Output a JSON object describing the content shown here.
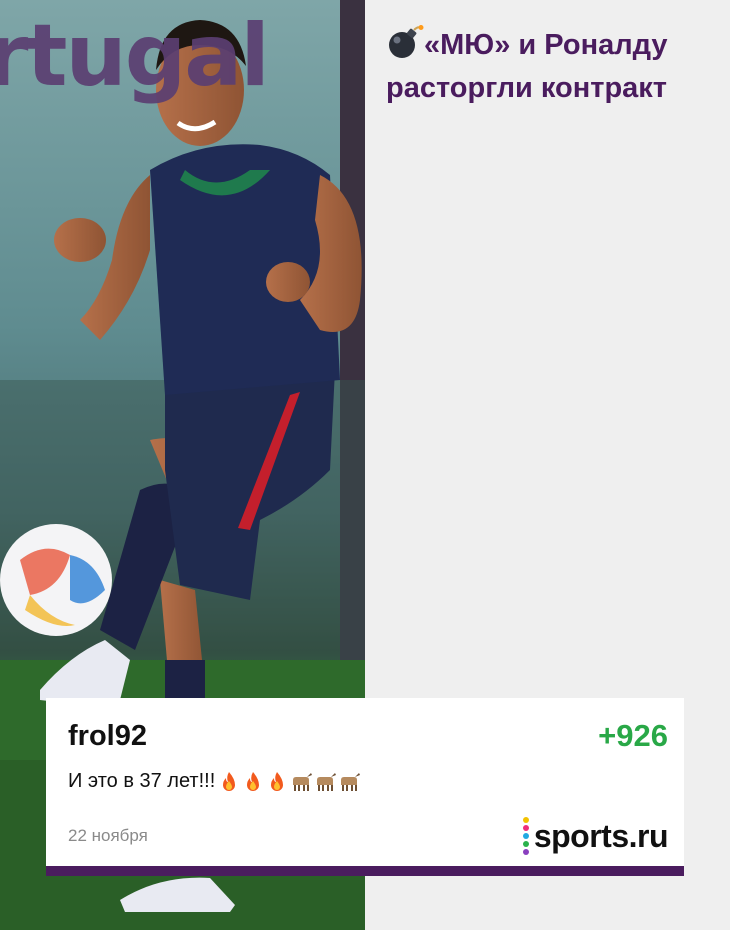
{
  "photo": {
    "wordmark": "rtugal",
    "description_icon": "football-player-photo"
  },
  "headline": {
    "icon": "bomb-icon",
    "line1": "«МЮ» и Роналду",
    "line2": "расторгли контракт"
  },
  "comment": {
    "author": "frol92",
    "rating": "+926",
    "text": "И это в 37 лет!!!",
    "emojis": [
      "fire",
      "fire",
      "fire",
      "goat",
      "goat",
      "goat"
    ],
    "date": "22 ноября"
  },
  "brand": {
    "logo_text": "sports.ru",
    "dot_colors": [
      "#f2c200",
      "#ee2e7a",
      "#21a9e1",
      "#2bb24c",
      "#8a3fbf"
    ]
  },
  "colors": {
    "accent_purple": "#4a1c5e",
    "rating_green": "#29a847",
    "background": "#efefef"
  }
}
